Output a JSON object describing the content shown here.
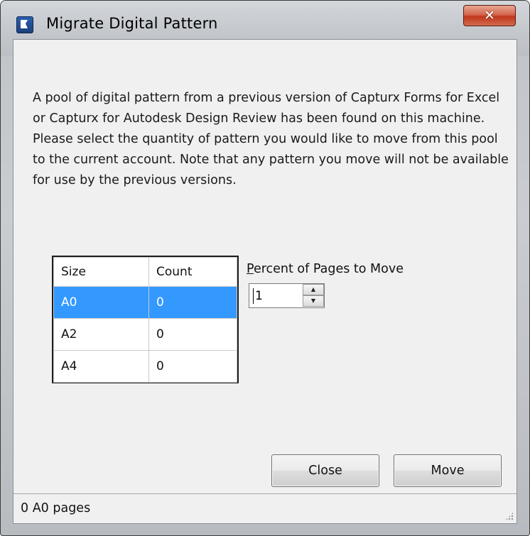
{
  "window": {
    "title": "Migrate Digital Pattern",
    "close_glyph": "✕",
    "icon": "flag-app-icon"
  },
  "description": "A pool of digital pattern from a previous version of Capturx Forms for Excel or Capturx for Autodesk Design Review has been found on this machine. Please select the quantity of pattern you would like to move from this pool to the current account. Note that any pattern you move will not be available for use by the previous versions.",
  "table": {
    "columns": [
      "Size",
      "Count"
    ],
    "rows": [
      {
        "size": "A0",
        "count": "0",
        "selected": true
      },
      {
        "size": "A2",
        "count": "0",
        "selected": false
      },
      {
        "size": "A4",
        "count": "0",
        "selected": false
      }
    ],
    "selection_color": "#3399ff"
  },
  "percent": {
    "label_accel": "P",
    "label_rest": "ercent of Pages to Move",
    "value": "1"
  },
  "buttons": {
    "close": "Close",
    "move": "Move"
  },
  "status": {
    "text": "0 A0 pages"
  }
}
